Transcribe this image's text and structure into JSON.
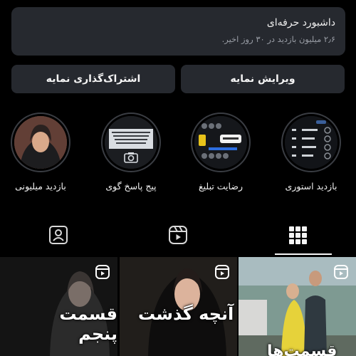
{
  "dashboard": {
    "title": "داشبورد حرفه‌ای",
    "subtitle": "۲٫۶ میلیون بازدید در ۳۰ روز اخیر."
  },
  "buttons": {
    "edit_label": "ویرایش نمایه",
    "share_label": "اشتراک‌گذاری نمایه"
  },
  "highlights": [
    {
      "label": "بازدید استوری",
      "icon": "stats-screenshot"
    },
    {
      "label": "رضایت تبلیغ",
      "icon": "message-screenshot"
    },
    {
      "label": "پیج پاسخ گوی",
      "icon": "text-post-camera"
    },
    {
      "label": "بازدید میلیونی",
      "icon": "woman-hijab-photo"
    }
  ],
  "tabs": [
    {
      "name": "grid",
      "icon": "grid-icon",
      "active": true
    },
    {
      "name": "reels",
      "icon": "reels-icon",
      "active": false
    },
    {
      "name": "tagged",
      "icon": "tagged-person-icon",
      "active": false
    }
  ],
  "posts": [
    {
      "caption": "قسمت‌ها",
      "type": "reel"
    },
    {
      "caption": "آنچه گذشت",
      "type": "reel"
    },
    {
      "caption": "قسمت پنجم",
      "type": "reel"
    }
  ],
  "colors": {
    "background": "#000000",
    "card": "#26292f",
    "subtext": "#9a9ea6"
  }
}
